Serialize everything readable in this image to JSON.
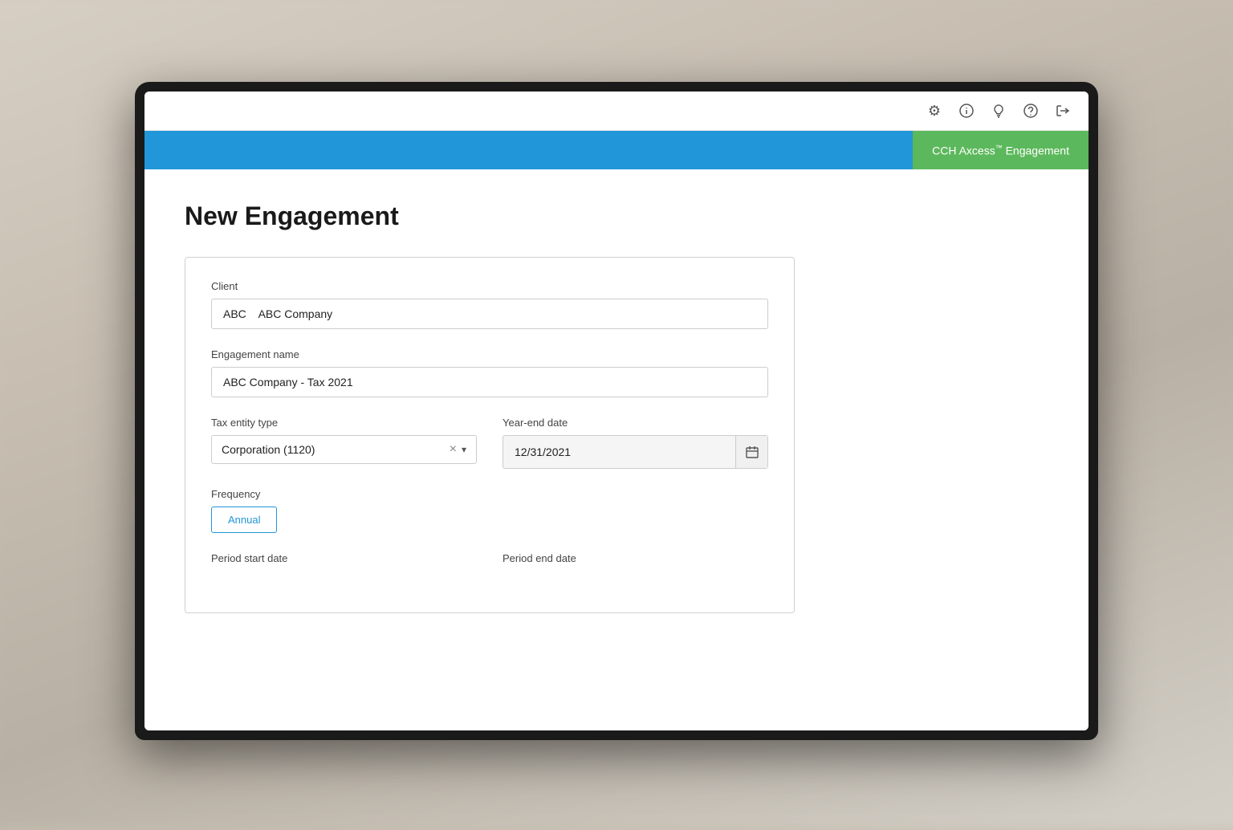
{
  "background": {
    "description": "blurred office background"
  },
  "topbar": {
    "icons": [
      {
        "name": "settings-icon",
        "symbol": "⚙",
        "label": "Settings"
      },
      {
        "name": "info-icon",
        "symbol": "ⓘ",
        "label": "Information"
      },
      {
        "name": "lightbulb-icon",
        "symbol": "💡",
        "label": "Ideas"
      },
      {
        "name": "help-icon",
        "symbol": "?",
        "label": "Help"
      },
      {
        "name": "logout-icon",
        "symbol": "⇥",
        "label": "Logout"
      }
    ]
  },
  "header": {
    "app_name": "CCH Axcess",
    "app_tm": "™",
    "app_module": " Engagement"
  },
  "page": {
    "title": "New Engagement"
  },
  "form": {
    "client_label": "Client",
    "client_value": "ABC    ABC Company",
    "engagement_name_label": "Engagement name",
    "engagement_name_value": "ABC Company - Tax 2021",
    "tax_entity_label": "Tax entity type",
    "tax_entity_value": "Corporation (1120)",
    "year_end_label": "Year-end date",
    "year_end_value": "12/31/2021",
    "frequency_label": "Frequency",
    "frequency_button": "Annual",
    "period_start_label": "Period start date",
    "period_end_label": "Period end date"
  }
}
